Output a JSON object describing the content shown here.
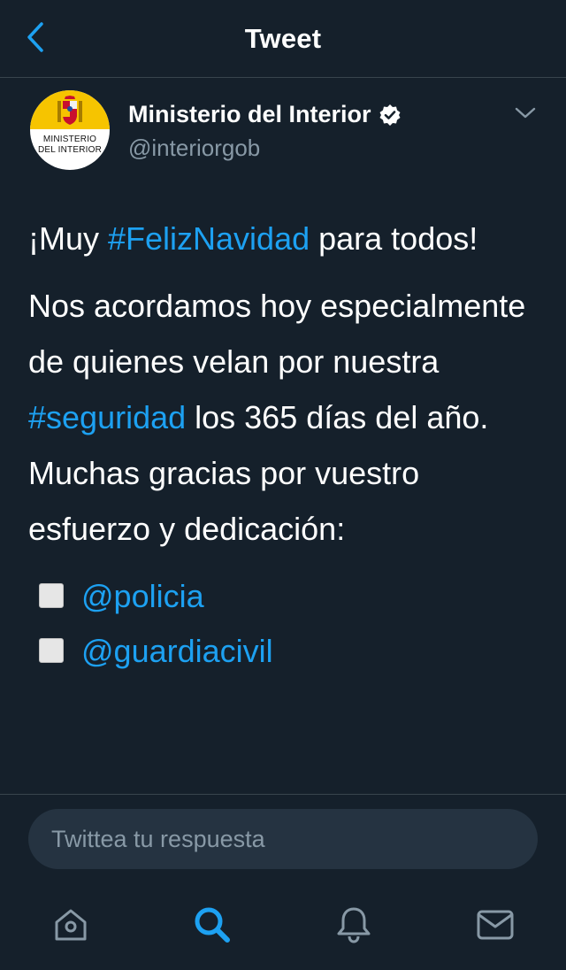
{
  "header": {
    "title": "Tweet",
    "back_icon": "chevron-left-icon"
  },
  "author": {
    "name": "Ministerio del Interior",
    "handle": "@interiorgob",
    "avatar_line1": "MINISTERIO",
    "avatar_line2": "DEL INTERIOR",
    "verified_icon": "verified-badge-icon",
    "more_icon": "chevron-down-icon"
  },
  "tweet": {
    "p1_before": "¡Muy ",
    "p1_hashtag": "#FelizNavidad",
    "p1_after": " para todos!",
    "p2_before": "Nos acordamos hoy especialmente de quienes velan por nuestra ",
    "p2_hashtag": "#seguridad",
    "p2_after": " los 365 días del año. Muchas gracias por vuestro esfuerzo y dedicación:",
    "mentions": [
      "@policia",
      "@guardiacivil"
    ]
  },
  "reply": {
    "placeholder": "Twittea tu respuesta"
  },
  "tabbar": {
    "items": [
      {
        "name": "home",
        "icon": "home-icon",
        "active": false
      },
      {
        "name": "search",
        "icon": "search-icon",
        "active": true
      },
      {
        "name": "notifications",
        "icon": "bell-icon",
        "active": false
      },
      {
        "name": "messages",
        "icon": "mail-icon",
        "active": false
      }
    ]
  },
  "colors": {
    "background": "#15202b",
    "accent": "#1da1f2",
    "secondary_text": "#8899a6",
    "divider": "#38444d"
  }
}
